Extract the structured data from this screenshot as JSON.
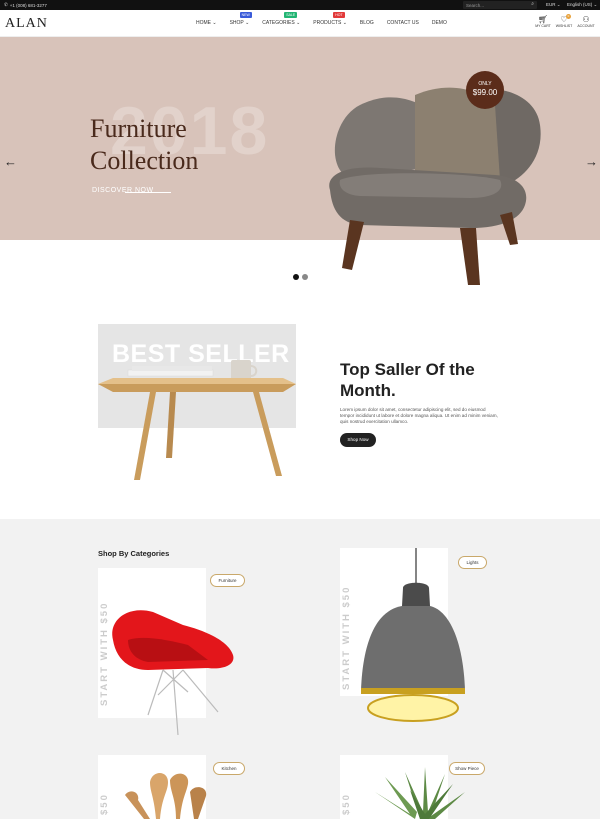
{
  "topbar": {
    "phone": "+1 (008) 681-3277",
    "search_placeholder": "Search...",
    "currency": "EUR ⌄",
    "language": "English (US) ⌄"
  },
  "header": {
    "logo": "ALAN",
    "nav": [
      {
        "label": "HOME ⌄",
        "badge": ""
      },
      {
        "label": "SHOP ⌄",
        "badge": "NEW",
        "badge_color": "#3a5bd9"
      },
      {
        "label": "CATEGORIES ⌄",
        "badge": "SALE",
        "badge_color": "#22b573"
      },
      {
        "label": "PRODUCTS ⌄",
        "badge": "HOT",
        "badge_color": "#e23a3a"
      },
      {
        "label": "BLOG",
        "badge": ""
      },
      {
        "label": "CONTACT US",
        "badge": ""
      },
      {
        "label": "DEMO",
        "badge": ""
      }
    ],
    "cart_label": "MY CART",
    "wishlist_label": "WISHLIST",
    "wishlist_count": "0",
    "account_label": "ACCOUNT"
  },
  "hero": {
    "bg_year": "2018",
    "title_line1": "Furniture",
    "title_line2": "Collection",
    "cta": "DISCOVER NOW",
    "price_label": "ONLY",
    "price": "$99.00",
    "prev_arrow": "←",
    "next_arrow": "→",
    "slide_count": 2,
    "active_slide": 1
  },
  "best": {
    "image_text": "BEST SELLER",
    "title_line1": "Top Saller Of the",
    "title_line2": "Month.",
    "description": "Lorem ipsum dolor sit amet, consectetur adipiscing elit, sed do eiusmod tempor incididunt ut labore et dolore magna aliqua. Ut enim ad minim veniam, quis nostrud exercitation ullamco.",
    "button": "Shop Now"
  },
  "categories": {
    "title": "Shop By Categories",
    "items": [
      {
        "label": "Furniture",
        "side_text": "START WITH $50"
      },
      {
        "label": "Lights",
        "side_text": "START WITH $50"
      },
      {
        "label": "Kitchen",
        "side_text": "$50"
      },
      {
        "label": "Show Piece",
        "side_text": "$50"
      }
    ]
  },
  "colors": {
    "hero_bg": "#d8c3ba",
    "accent_brown": "#5b2c1a",
    "section_bg": "#f2f2f2"
  }
}
